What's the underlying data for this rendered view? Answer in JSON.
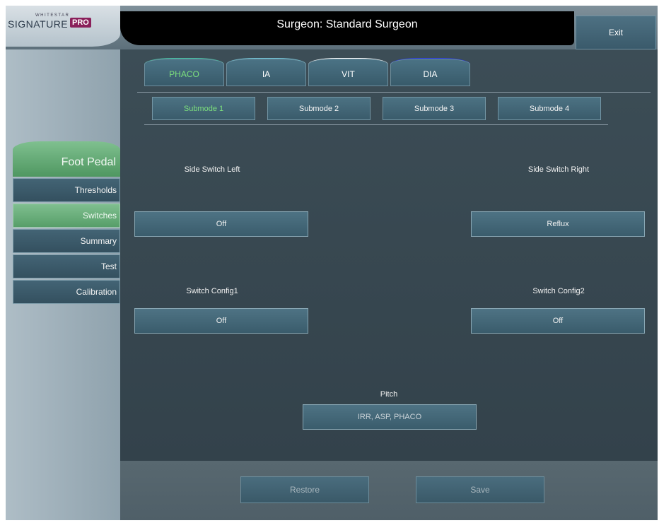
{
  "logo": {
    "top": "WHITESTAR",
    "name": "SIGNATURE",
    "badge": "PRO"
  },
  "header": {
    "title": "Surgeon:  Standard Surgeon",
    "exit_label": "Exit"
  },
  "sidebar": {
    "section": "Foot Pedal",
    "items": [
      {
        "label": "Thresholds",
        "active": false
      },
      {
        "label": "Switches",
        "active": true
      },
      {
        "label": "Summary",
        "active": false
      },
      {
        "label": "Test",
        "active": false
      },
      {
        "label": "Calibration",
        "active": false
      }
    ]
  },
  "tabs": [
    {
      "label": "PHACO",
      "active": true,
      "accent": "#3fbfa0"
    },
    {
      "label": "IA",
      "active": false,
      "accent": "#6fc3d6"
    },
    {
      "label": "VIT",
      "active": false,
      "accent": "#ffffff"
    },
    {
      "label": "DIA",
      "active": false,
      "accent": "#2233dd"
    }
  ],
  "submodes": [
    {
      "label": "Submode 1",
      "active": true
    },
    {
      "label": "Submode 2",
      "active": false
    },
    {
      "label": "Submode 3",
      "active": false
    },
    {
      "label": "Submode 4",
      "active": false
    }
  ],
  "switches": {
    "left_label": "Side Switch Left",
    "left_value": "Off",
    "right_label": "Side Switch Right",
    "right_value": "Reflux",
    "config1_label": "Switch Config1",
    "config1_value": "Off",
    "config2_label": "Switch Config2",
    "config2_value": "Off"
  },
  "pitch": {
    "label": "Pitch",
    "value": "IRR, ASP, PHACO"
  },
  "footer": {
    "restore_label": "Restore",
    "save_label": "Save"
  },
  "colors": {
    "active_text": "#7de07d",
    "active_green": "#5fa872",
    "button_blue": "#436879",
    "background": "#3d4f5a"
  }
}
